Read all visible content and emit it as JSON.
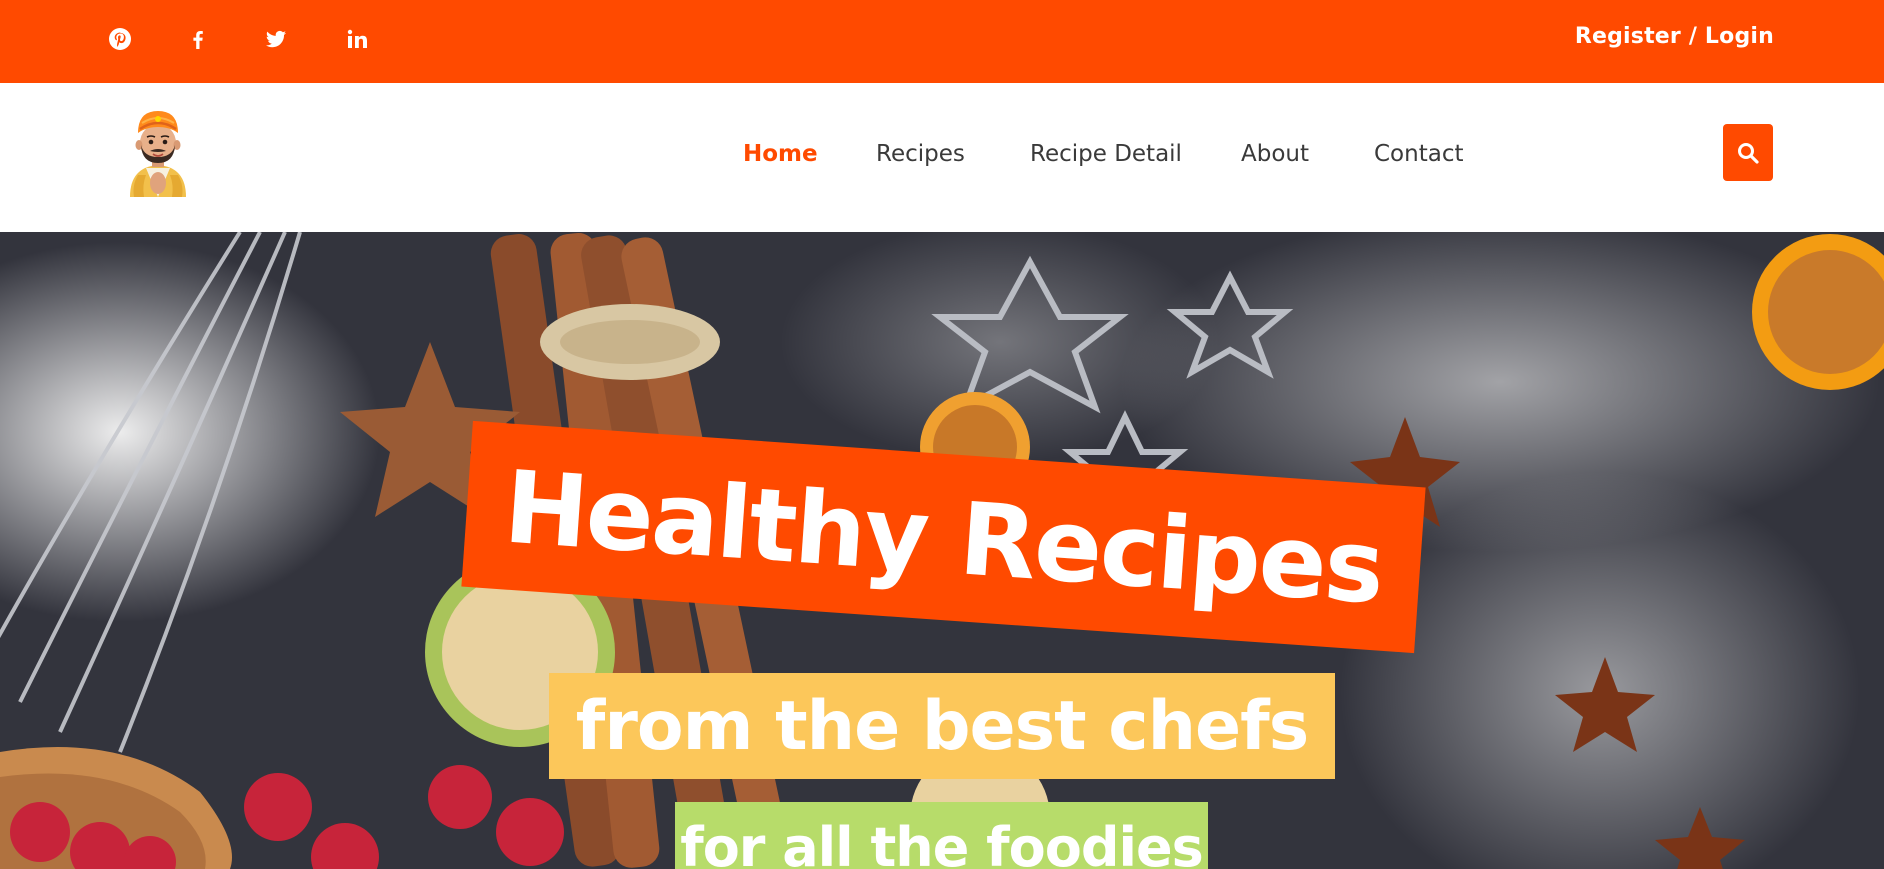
{
  "topbar": {
    "background": "#ff4a00",
    "social": [
      {
        "icon": "pinterest-icon"
      },
      {
        "icon": "facebook-icon"
      },
      {
        "icon": "twitter-icon"
      },
      {
        "icon": "linkedin-icon"
      }
    ],
    "register_login": "Register / Login"
  },
  "nav": {
    "logo_icon": "chef-mascot-icon",
    "items": [
      {
        "label": "Home",
        "active": true
      },
      {
        "label": "Recipes",
        "active": false
      },
      {
        "label": "Recipe Detail",
        "active": false
      },
      {
        "label": "About",
        "active": false
      },
      {
        "label": "Contact",
        "active": false
      }
    ],
    "search_icon": "search-icon",
    "accent": "#ff4a00"
  },
  "hero": {
    "headline": "Healthy Recipes",
    "subline": "from the best chefs",
    "tagline": "for all the foodies",
    "colors": {
      "headline_bg": "#ff4a00",
      "subline_bg": "#fcc75a",
      "tagline_bg": "#b7dc6a"
    }
  }
}
